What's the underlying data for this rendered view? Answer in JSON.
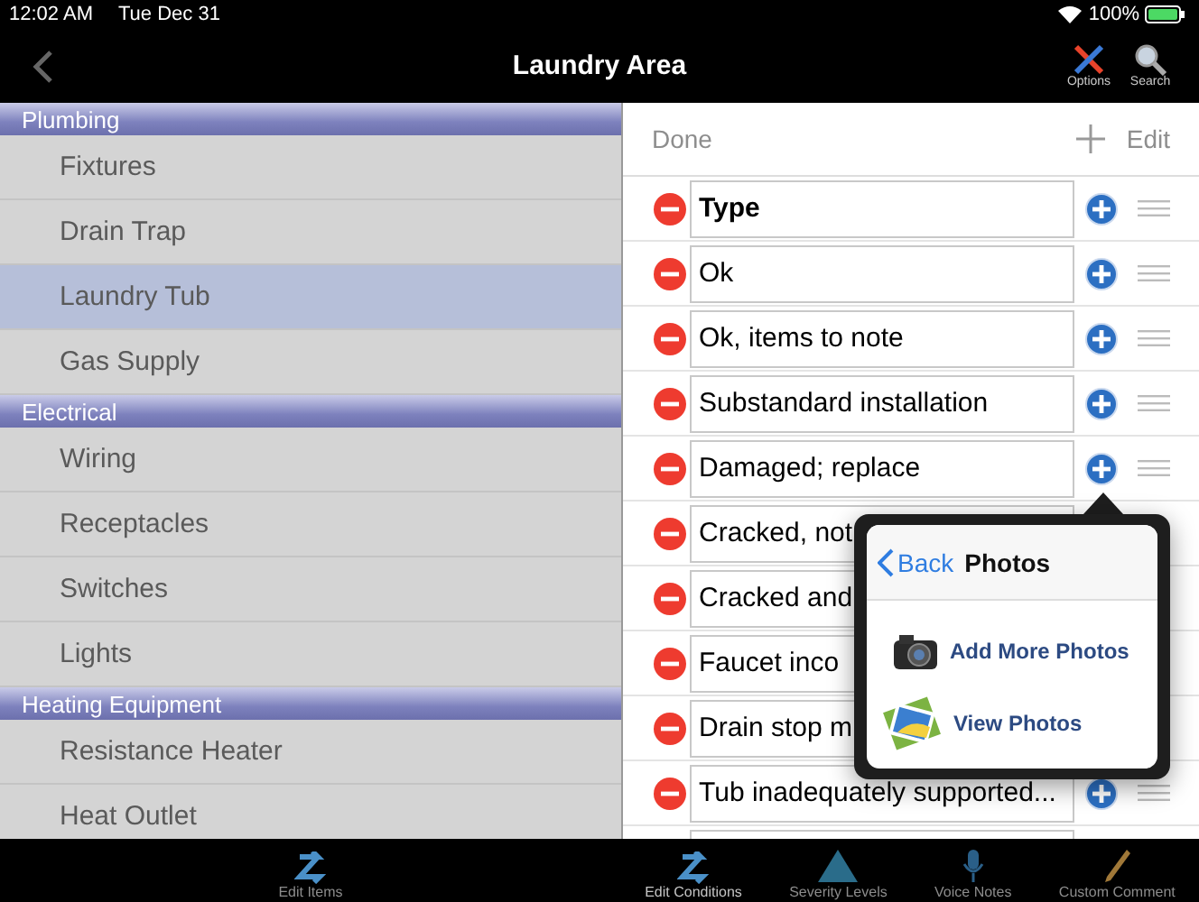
{
  "status_bar": {
    "time": "12:02 AM",
    "date": "Tue Dec 31",
    "battery": "100%"
  },
  "nav_bar": {
    "title": "Laundry Area",
    "buttons": [
      {
        "kind": "options",
        "label": "Options"
      },
      {
        "kind": "search",
        "label": "Search"
      }
    ]
  },
  "sidebar": {
    "sections": [
      {
        "title": "Plumbing",
        "items": [
          {
            "label": "Fixtures",
            "selected": false
          },
          {
            "label": "Drain Trap",
            "selected": false
          },
          {
            "label": "Laundry Tub",
            "selected": true
          },
          {
            "label": "Gas Supply",
            "selected": false
          }
        ]
      },
      {
        "title": "Electrical",
        "items": [
          {
            "label": "Wiring",
            "selected": false
          },
          {
            "label": "Receptacles",
            "selected": false
          },
          {
            "label": "Switches",
            "selected": false
          },
          {
            "label": "Lights",
            "selected": false
          }
        ]
      },
      {
        "title": "Heating Equipment",
        "items": [
          {
            "label": "Resistance Heater",
            "selected": false
          },
          {
            "label": "Heat Outlet",
            "selected": false
          }
        ]
      }
    ]
  },
  "conditions": {
    "done": "Done",
    "edit": "Edit",
    "rows": [
      {
        "text": "Type",
        "bold": true,
        "controls": true
      },
      {
        "text": "Ok",
        "bold": false,
        "controls": true
      },
      {
        "text": "Ok, items to note",
        "bold": false,
        "controls": true
      },
      {
        "text": "Substandard installation",
        "bold": false,
        "controls": true
      },
      {
        "text": "Damaged; replace",
        "bold": false,
        "controls": true
      },
      {
        "text": "Cracked, not",
        "bold": false
      },
      {
        "text": "Cracked and",
        "bold": false
      },
      {
        "text": "Faucet inco",
        "bold": false
      },
      {
        "text": "Drain stop m",
        "bold": false
      },
      {
        "text": "Tub inadequately supported...",
        "bold": false,
        "controls": true
      },
      {
        "text": ""
      }
    ]
  },
  "popover": {
    "back": "Back",
    "title": "Photos",
    "items": [
      {
        "kind": "camera",
        "label": "Add More Photos"
      },
      {
        "kind": "gallery",
        "label": "View Photos"
      }
    ]
  },
  "tab_bar": {
    "left": [
      {
        "kind": "edit",
        "label": "Edit Items",
        "selected": false
      }
    ],
    "right": [
      {
        "kind": "edit",
        "label": "Edit Conditions",
        "selected": true
      },
      {
        "kind": "warning",
        "label": "Severity Levels",
        "selected": false
      },
      {
        "kind": "mic",
        "label": "Voice Notes",
        "selected": false
      },
      {
        "kind": "pencil",
        "label": "Custom Comment",
        "selected": false
      }
    ]
  }
}
